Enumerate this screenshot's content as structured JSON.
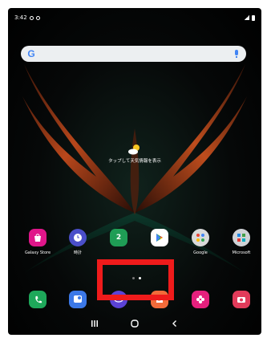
{
  "status_bar": {
    "time": "3:42"
  },
  "search": {
    "logo": "G",
    "mic_icon": "mic-icon"
  },
  "weather": {
    "label": "タップして天気情報を表示",
    "icon": "weather-sun-cloud-icon"
  },
  "dock_row_top": [
    {
      "label": "Galaxy Store",
      "icon": "galaxy-store-icon",
      "color": "#e0168a"
    },
    {
      "label": "時計",
      "icon": "clock-icon",
      "color": "#4a4fc9"
    },
    {
      "label": "",
      "icon": "calendar-icon",
      "color": "#1f9d55",
      "glyph": "2"
    },
    {
      "label": "",
      "icon": "play-store-icon",
      "color": "#ffffff"
    },
    {
      "label": "Google",
      "icon": "google-folder-icon",
      "color": "#d9d9d9"
    },
    {
      "label": "Microsoft",
      "icon": "microsoft-folder-icon",
      "color": "#cfd2d6"
    }
  ],
  "dock_row_bottom": [
    {
      "icon": "phone-icon",
      "color": "#1ea85a"
    },
    {
      "icon": "messages-icon",
      "color": "#3b78e7"
    },
    {
      "icon": "internet-icon",
      "color": "#5b43d6"
    },
    {
      "icon": "notes-icon",
      "color": "#f26b3a"
    },
    {
      "icon": "bixby-icon",
      "color": "#e5207d"
    },
    {
      "icon": "camera-icon",
      "color": "#e23b5a"
    }
  ],
  "page_indicator": {
    "pages": 2,
    "active": 2
  },
  "colors": {
    "highlight": "#ef1b1b"
  }
}
